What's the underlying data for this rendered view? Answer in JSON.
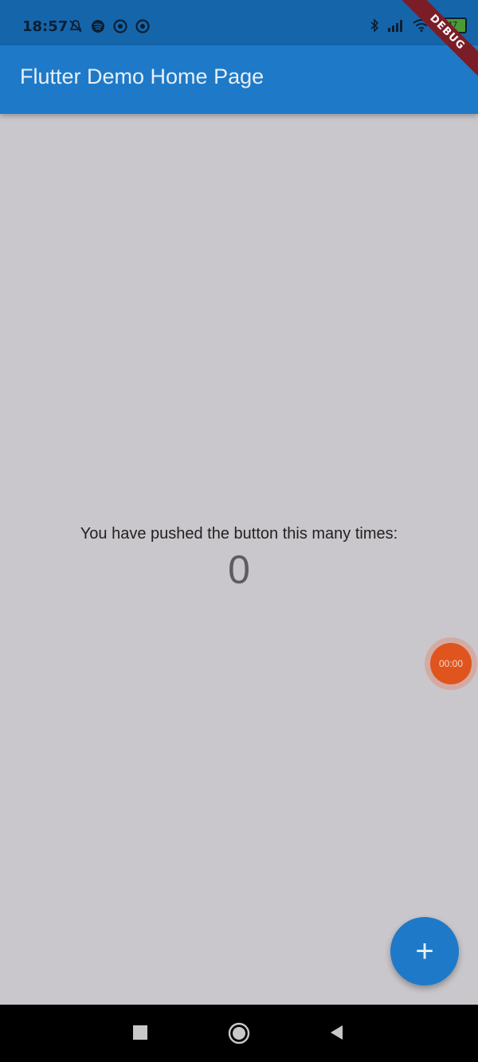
{
  "status_bar": {
    "time": "18:57",
    "battery_level": "47",
    "icons": [
      "bell-off-icon",
      "spotify-icon",
      "app-icon",
      "app-icon",
      "bluetooth-icon",
      "signal-icon",
      "wifi-icon",
      "battery-icon"
    ]
  },
  "debug_banner": {
    "label": "DEBUG"
  },
  "app_bar": {
    "title": "Flutter Demo Home Page"
  },
  "main": {
    "push_label": "You have pushed the button this many times:",
    "counter": "0"
  },
  "recorder": {
    "time": "00:00"
  },
  "fab": {
    "label": "+"
  },
  "nav_bar": {
    "buttons": [
      "recents-icon",
      "home-icon",
      "back-icon"
    ]
  },
  "colors": {
    "app_bar": "#1e7ac8",
    "status_bar": "#1565ab",
    "background": "#c9c7cb",
    "debug_banner": "#7a1d27",
    "recorder": "#e0541d"
  }
}
